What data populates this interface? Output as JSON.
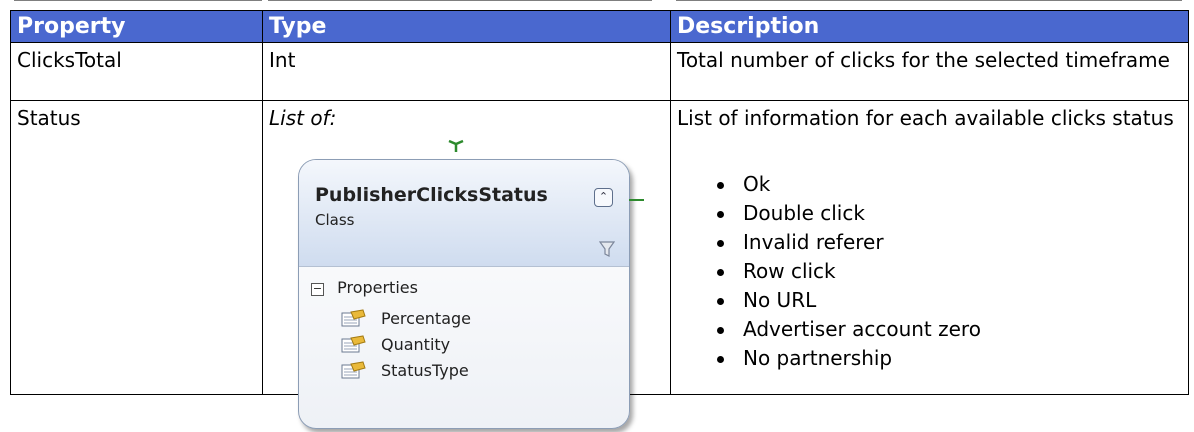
{
  "table": {
    "headers": {
      "property": "Property",
      "type": "Type",
      "description": "Description"
    },
    "rows": [
      {
        "property": "ClicksTotal",
        "type": "Int",
        "description": "Total number of clicks for the selected timeframe"
      },
      {
        "property": "Status",
        "type_prefix": "List of:",
        "description": "List of information for each available clicks status",
        "status_values": [
          "Ok",
          "Double click",
          "Invalid referer",
          "Row click",
          "No URL",
          "Advertiser account zero",
          "No partnership"
        ]
      }
    ]
  },
  "class_diagram": {
    "class_name": "PublisherClicksStatus",
    "class_kind": "Class",
    "section_label": "Properties",
    "properties": [
      "Percentage",
      "Quantity",
      "StatusType"
    ],
    "colors": {
      "header_blue": "#4a68cf",
      "connector_green": "#2d8a2d"
    }
  }
}
